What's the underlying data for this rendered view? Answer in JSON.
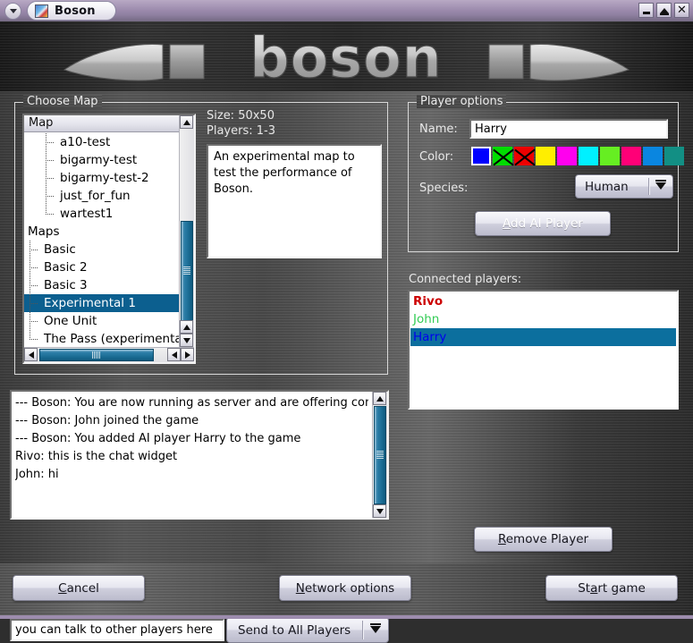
{
  "window": {
    "title": "Boson",
    "menu_icon": "chevron-down-icon",
    "app_icon": "boson-app-icon",
    "minimize_label": "",
    "maximize_label": "",
    "close_label": "✕"
  },
  "banner": {
    "wordmark": "boson"
  },
  "choose_map": {
    "title": "Choose Map",
    "tree_header": "Map",
    "items": [
      {
        "label": "a10-test",
        "depth": 2,
        "selected": false,
        "last": false
      },
      {
        "label": "bigarmy-test",
        "depth": 2,
        "selected": false,
        "last": false
      },
      {
        "label": "bigarmy-test-2",
        "depth": 2,
        "selected": false,
        "last": false
      },
      {
        "label": "just_for_fun",
        "depth": 2,
        "selected": false,
        "last": false
      },
      {
        "label": "wartest1",
        "depth": 2,
        "selected": false,
        "last": true
      },
      {
        "label": "Maps",
        "depth": 0,
        "selected": false,
        "last": false
      },
      {
        "label": "Basic",
        "depth": 1,
        "selected": false,
        "last": false
      },
      {
        "label": "Basic 2",
        "depth": 1,
        "selected": false,
        "last": false
      },
      {
        "label": "Basic 3",
        "depth": 1,
        "selected": false,
        "last": false
      },
      {
        "label": "Experimental 1",
        "depth": 1,
        "selected": true,
        "last": false
      },
      {
        "label": "One Unit",
        "depth": 1,
        "selected": false,
        "last": false
      },
      {
        "label": "The Pass (experimenta",
        "depth": 1,
        "selected": false,
        "last": true
      }
    ]
  },
  "map_info": {
    "size": "Size: 50x50",
    "players": "Players: 1-3",
    "description": "An experimental map to test the performance of Boson."
  },
  "player_options": {
    "title": "Player options",
    "name_label": "Name:",
    "name_value": "Harry",
    "color_label": "Color:",
    "colors": [
      {
        "hex": "#0000ff",
        "selected": true,
        "crossed": false
      },
      {
        "hex": "#00dd00",
        "selected": false,
        "crossed": true
      },
      {
        "hex": "#ee0000",
        "selected": false,
        "crossed": true
      },
      {
        "hex": "#ffee00",
        "selected": false,
        "crossed": false
      },
      {
        "hex": "#ff00ee",
        "selected": false,
        "crossed": false
      },
      {
        "hex": "#00f0ff",
        "selected": false,
        "crossed": false
      },
      {
        "hex": "#66ee22",
        "selected": false,
        "crossed": false
      },
      {
        "hex": "#ff0077",
        "selected": false,
        "crossed": false
      },
      {
        "hex": "#0a86e0",
        "selected": false,
        "crossed": false
      },
      {
        "hex": "#128f84",
        "selected": false,
        "crossed": false
      }
    ],
    "species_label": "Species:",
    "species_value": "Human",
    "species_options": [
      "Human"
    ],
    "add_ai_label": "Add AI Player",
    "add_ai_accel": "A",
    "add_ai_disabled": true
  },
  "connected_players": {
    "label": "Connected players:",
    "items": [
      {
        "name": "Rivo",
        "color": "#cc0000",
        "bold": true,
        "selected": false,
        "text_color_selected": ""
      },
      {
        "name": "John",
        "color": "#33cc55",
        "bold": false,
        "selected": false,
        "text_color_selected": ""
      },
      {
        "name": "Harry",
        "color": "#0000ee",
        "bold": false,
        "selected": true,
        "text_color_selected": "#0000ee"
      }
    ],
    "remove_label": "Remove Player",
    "remove_accel": "R"
  },
  "chat": {
    "lines": [
      "--- Boson: You are now running as server and are offering con",
      "--- Boson: John joined the game",
      "--- Boson: You added AI player Harry to the game",
      "Rivo: this is the chat widget",
      "John: hi"
    ],
    "input_value": "you can talk to other players here",
    "input_placeholder": "you can talk to other players here",
    "send_target": "Send to All Players",
    "send_options": [
      "Send to All Players"
    ]
  },
  "footer": {
    "cancel_label": "Cancel",
    "cancel_accel": "C",
    "network_label": "Network options",
    "network_accel": "N",
    "start_label": "Start game",
    "start_accel": "a"
  },
  "colors": {
    "titlebar": "#9d8cae",
    "selection": "#0c5f8f",
    "panel_text": "#e8e8e8"
  }
}
